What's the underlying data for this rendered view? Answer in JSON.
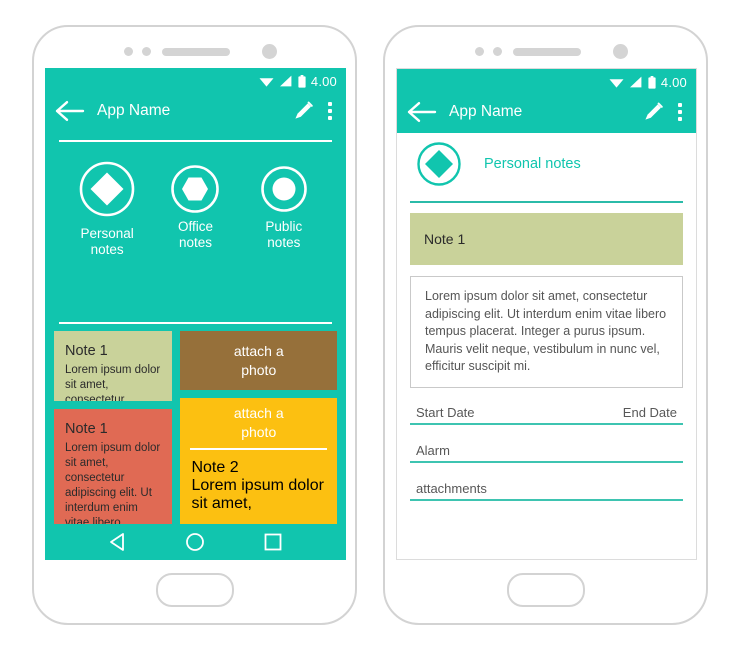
{
  "status": {
    "time": "4.00",
    "wifi_icon": "wifi-icon",
    "signal_icon": "signal-bars-icon",
    "battery_icon": "battery-icon"
  },
  "phone_list": {
    "appbar": {
      "back_icon": "back-arrow-icon",
      "title": "App Name",
      "edit_icon": "pencil-edit-icon",
      "overflow_icon": "overflow-menu-icon"
    },
    "categories": [
      {
        "label": "Personal\nnotes",
        "label_line1": "Personal",
        "label_line2": "notes",
        "icon": "diamond-icon"
      },
      {
        "label": "Office\nnotes",
        "label_line1": "Office",
        "label_line2": "notes",
        "icon": "hexagon-icon"
      },
      {
        "label": "Public\nnotes",
        "label_line1": "Public",
        "label_line2": "notes",
        "icon": "circle-icon"
      }
    ],
    "cards": {
      "olive": {
        "title": "Note 1",
        "body": "Lorem ipsum dolor sit amet, consectetur adipiscing elit",
        "color": "#c9d29a"
      },
      "salmon": {
        "title": "Note 1",
        "body": "Lorem ipsum dolor sit amet, consectetur adipiscing elit. Ut interdum enim vitae libero tempus placerat.",
        "color": "#e06a54"
      },
      "brown": {
        "attach_line1": "attach a",
        "attach_line2": "photo",
        "color": "#96703a"
      },
      "yellow": {
        "attach_line1": "attach a",
        "attach_line2": "photo",
        "title": "Note 2",
        "body": "Lorem ipsum dolor sit amet,",
        "color": "#fcc011"
      }
    },
    "navbar": {
      "back_icon": "nav-back-triangle-icon",
      "home_icon": "nav-home-circle-icon",
      "recents_icon": "nav-recents-square-icon"
    }
  },
  "phone_detail": {
    "appbar": {
      "back_icon": "back-arrow-icon",
      "title": "App Name",
      "edit_icon": "pencil-edit-icon",
      "overflow_icon": "overflow-menu-icon"
    },
    "category": {
      "icon": "diamond-icon",
      "label": "Personal notes"
    },
    "note": {
      "title": "Note 1",
      "body": "Lorem ipsum dolor sit amet, consectetur adipiscing elit. Ut interdum enim vitae libero tempus placerat. Integer a purus ipsum. Mauris velit neque, vestibulum in nunc vel, efficitur suscipit mi."
    },
    "fields": {
      "start_date": "Start Date",
      "end_date": "End Date",
      "alarm": "Alarm",
      "attachments": "attachments"
    }
  },
  "theme": {
    "teal": "#11c5ae",
    "teal_line": "#3ec4b1",
    "olive": "#c9d29a",
    "salmon": "#e06a54",
    "brown": "#96703a",
    "yellow": "#fcc011",
    "frame": "#d3d3d3"
  }
}
